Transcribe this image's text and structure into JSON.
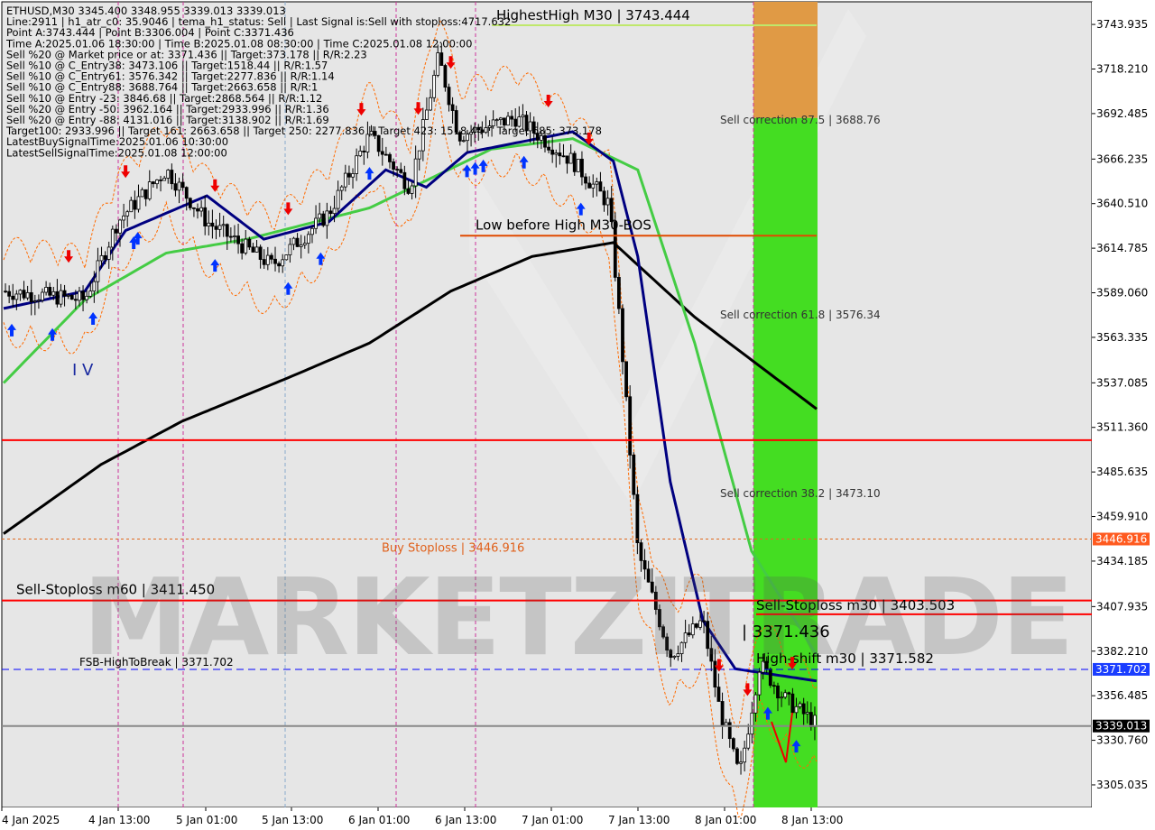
{
  "info_lines": [
    "ETHUSD,M30  3345.400 3348.955 3339.013 3339.013",
    "Line:2911 | h1_atr_c0: 35.9046 | tema_h1_status: Sell | Last Signal is:Sell with stoploss:4717.632",
    "Point A:3743.444 | Point B:3306.004 | Point C:3371.436",
    "Time A:2025.01.06 18:30:00 | Time B:2025.01.08 08:30:00 | Time C:2025.01.08 12:00:00",
    "Sell %20 @ Market price or at: 3371.436 || Target:373.178 || R/R:2.23",
    "Sell %10 @ C_Entry38: 3473.106 || Target:1518.44 || R/R:1.57",
    "Sell %10 @ C_Entry61: 3576.342 || Target:2277.836 || R/R:1.14",
    "Sell %10 @ C_Entry88: 3688.764 || Target:2663.658 || R/R:1",
    "Sell %10 @ Entry -23: 3846.68 || Target:2868.564 || R/R:1.12",
    "Sell %20 @ Entry -50: 3962.164 || Target:2933.996 || R/R:1.36",
    "Sell %20 @ Entry -88: 4131.016 || Target:3138.902 || R/R:1.69",
    "Target100: 2933.996 || Target 161: 2663.658 || Target 250: 2277.836 || Target 423: 1518.44 || Target 685: 373.178",
    "LatestBuySignalTime:2025.01.06 10:30:00",
    "LatestSellSignalTime:2025.01.08 12:00:00"
  ],
  "watermark": "MARKETZITRADE",
  "colors": {
    "background": "#ffffff",
    "plot_bg": "#e6e6e6",
    "green_zone": "#44dd22",
    "orange_zone": "#e09a45",
    "red_line": "#ff0000",
    "blue_dash": "#0000ff",
    "ma_fast": "#000080",
    "ma_mid": "#44cc44",
    "ma_slow": "#000000",
    "band": "#ff6a00",
    "candle": "#000000",
    "buy_arrow": "#0033ff",
    "sell_arrow": "#ee0000"
  },
  "chart_data": {
    "type": "candlestick",
    "symbol": "ETHUSD",
    "timeframe": "M30",
    "ylim": [
      3292.0,
      3757.0
    ],
    "y_ticks": [
      "3743.935",
      "3718.210",
      "3692.485",
      "3666.235",
      "3640.510",
      "3614.785",
      "3589.060",
      "3563.335",
      "3537.085",
      "3511.360",
      "3485.635",
      "3459.910",
      "3434.185",
      "3407.935",
      "3382.210",
      "3356.485",
      "3330.760",
      "3305.035"
    ],
    "x_ticks": [
      "4 Jan 2025",
      "4 Jan 13:00",
      "5 Jan 01:00",
      "5 Jan 13:00",
      "6 Jan 01:00",
      "6 Jan 13:00",
      "7 Jan 01:00",
      "7 Jan 13:00",
      "8 Jan 01:00",
      "8 Jan 13:00"
    ],
    "price_key_points": [
      {
        "t": 0,
        "p": 3590
      },
      {
        "t": 0.1,
        "p": 3585
      },
      {
        "t": 0.14,
        "p": 3630
      },
      {
        "t": 0.2,
        "p": 3660
      },
      {
        "t": 0.25,
        "p": 3630
      },
      {
        "t": 0.33,
        "p": 3605
      },
      {
        "t": 0.4,
        "p": 3635
      },
      {
        "t": 0.45,
        "p": 3680
      },
      {
        "t": 0.5,
        "p": 3650
      },
      {
        "t": 0.535,
        "p": 3725
      },
      {
        "t": 0.56,
        "p": 3680
      },
      {
        "t": 0.63,
        "p": 3690
      },
      {
        "t": 0.7,
        "p": 3665
      },
      {
        "t": 0.745,
        "p": 3640
      },
      {
        "t": 0.76,
        "p": 3560
      },
      {
        "t": 0.78,
        "p": 3440
      },
      {
        "t": 0.82,
        "p": 3380
      },
      {
        "t": 0.86,
        "p": 3400
      },
      {
        "t": 0.88,
        "p": 3350
      },
      {
        "t": 0.905,
        "p": 3310
      },
      {
        "t": 0.93,
        "p": 3375
      },
      {
        "t": 0.96,
        "p": 3355
      },
      {
        "t": 1.0,
        "p": 3340
      }
    ],
    "ma_fast_points": [
      {
        "t": 0,
        "p": 3580
      },
      {
        "t": 0.1,
        "p": 3590
      },
      {
        "t": 0.15,
        "p": 3625
      },
      {
        "t": 0.25,
        "p": 3645
      },
      {
        "t": 0.32,
        "p": 3620
      },
      {
        "t": 0.4,
        "p": 3630
      },
      {
        "t": 0.47,
        "p": 3660
      },
      {
        "t": 0.52,
        "p": 3650
      },
      {
        "t": 0.57,
        "p": 3670
      },
      {
        "t": 0.7,
        "p": 3682
      },
      {
        "t": 0.75,
        "p": 3665
      },
      {
        "t": 0.78,
        "p": 3610
      },
      {
        "t": 0.82,
        "p": 3480
      },
      {
        "t": 0.86,
        "p": 3400
      },
      {
        "t": 0.9,
        "p": 3372
      },
      {
        "t": 1.0,
        "p": 3365
      }
    ],
    "ma_mid_points": [
      {
        "t": 0,
        "p": 3537
      },
      {
        "t": 0.1,
        "p": 3585
      },
      {
        "t": 0.2,
        "p": 3612
      },
      {
        "t": 0.3,
        "p": 3620
      },
      {
        "t": 0.45,
        "p": 3638
      },
      {
        "t": 0.6,
        "p": 3672
      },
      {
        "t": 0.7,
        "p": 3678
      },
      {
        "t": 0.78,
        "p": 3660
      },
      {
        "t": 0.85,
        "p": 3560
      },
      {
        "t": 0.92,
        "p": 3440
      },
      {
        "t": 1.0,
        "p": 3380
      }
    ],
    "ma_slow_points": [
      {
        "t": 0,
        "p": 3450
      },
      {
        "t": 0.12,
        "p": 3490
      },
      {
        "t": 0.22,
        "p": 3515
      },
      {
        "t": 0.35,
        "p": 3540
      },
      {
        "t": 0.45,
        "p": 3560
      },
      {
        "t": 0.55,
        "p": 3590
      },
      {
        "t": 0.65,
        "p": 3610
      },
      {
        "t": 0.75,
        "p": 3618
      },
      {
        "t": 0.85,
        "p": 3575
      },
      {
        "t": 1.0,
        "p": 3522
      }
    ],
    "horizontal_levels": [
      {
        "price": 3743.444,
        "label": "HighestHigh   M30 | 3743.444",
        "color": "#bfe86b",
        "style": "solid"
      },
      {
        "price": 3622.0,
        "label": "Low before High   M30-BOS",
        "color": "#e04a00",
        "style": "solid"
      },
      {
        "price": 3504.0,
        "label": "",
        "color": "#ff0000",
        "style": "solid"
      },
      {
        "price": 3446.916,
        "label": "Buy Stoploss | 3446.916",
        "color": "#e06a20",
        "style": "dotted"
      },
      {
        "price": 3411.45,
        "label": "Sell-Stoploss m60 | 3411.450",
        "color": "#ff0000",
        "style": "solid"
      },
      {
        "price": 3403.503,
        "label": "Sell-Stoploss m30 | 3403.503",
        "color": "#ff0000",
        "style": "solid"
      },
      {
        "price": 3371.702,
        "label": "FSB-HighToBreak | 3371.702",
        "color": "#0000ff",
        "style": "dashed"
      },
      {
        "price": 3371.582,
        "label": "High-shift m30 | 3371.582",
        "color": "#0000ff",
        "style": "none"
      },
      {
        "price": 3339.013,
        "label": "",
        "color": "#888888",
        "style": "solid"
      }
    ],
    "fib_labels": [
      {
        "price": 3688.76,
        "label": "Sell correction 87.5 | 3688.76"
      },
      {
        "price": 3576.34,
        "label": "Sell correction 61.8 | 3576.34"
      },
      {
        "price": 3473.1,
        "label": "Sell correction 38.2 | 3473.10"
      }
    ],
    "point_c_label": "| 3371.436",
    "wave_label": "I V",
    "price_tags": [
      {
        "price": 3446.916,
        "text": "3446.916",
        "color": "#ff5a1f"
      },
      {
        "price": 3371.702,
        "text": "3371.702",
        "color": "#1a3dff"
      },
      {
        "price": 3339.013,
        "text": "3339.013",
        "color": "#000000"
      }
    ]
  }
}
